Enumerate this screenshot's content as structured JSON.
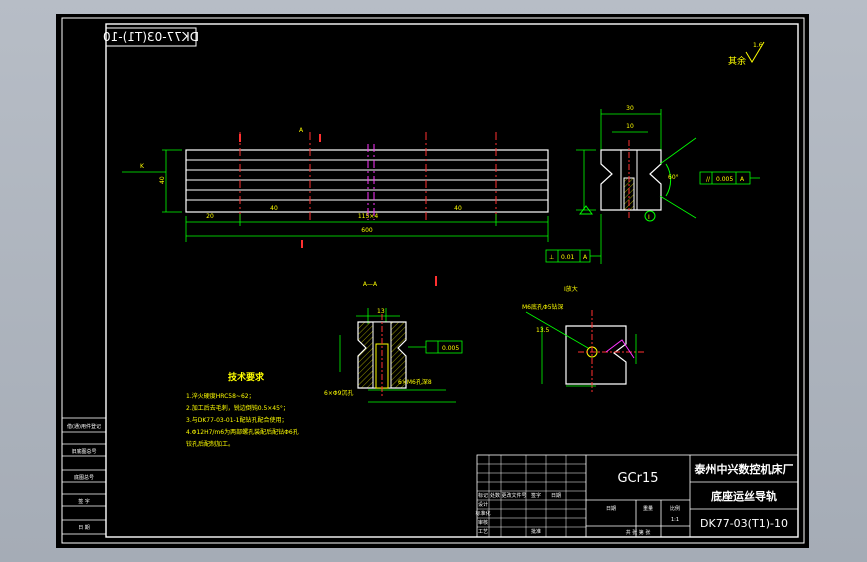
{
  "drawing": {
    "mirrored_code": "DK77-03(T1)-10",
    "roughness_note": "其余",
    "roughness_value": "1.6",
    "section_label": "A—A",
    "view_label": "I放大",
    "section_marker": "A",
    "dim_total": "600",
    "dim_spacing": "115×4",
    "dim_left_a": "40",
    "dim_left_b": "20",
    "dim_right_a": "40",
    "dim_height": "40",
    "dim_side_width": "30",
    "dim_side_inner": "10",
    "dim_angle": "60°",
    "flatness": "0.005",
    "parallel_a": "0.01",
    "parallel_ref": "A",
    "section_tol": "0.005",
    "section_dim_a": "13",
    "section_hole_a": "6×M6孔深8",
    "section_hole_b": "6×Φ9沉孔",
    "detail_note": "M6底孔Φ5钻深",
    "detail_dim": "13.5"
  },
  "tech_requirements": {
    "title": "技术要求",
    "items": [
      "1.淬火硬度HRC58~62；",
      "2.加工后去毛刺，锐边倒钝0.5×45°；",
      "3.与DK77-03-01-1配钻孔配合使用；",
      "4.Φ12H7/m6为两部螺孔装配后配钻Φ6孔",
      "  铰孔后配制加工。"
    ]
  },
  "left_strip": {
    "rows": [
      "借(通)用件登记",
      "",
      "旧底图总号",
      "",
      "底图总号",
      "",
      "签  字",
      "",
      "日  期"
    ]
  },
  "title_block": {
    "material": "GCr15",
    "company": "泰州中兴数控机床厂",
    "part_name": "底座运丝导轨",
    "drawing_number": "DK77-03(T1)-10",
    "scale": "1:1",
    "headers": [
      "标记",
      "处数",
      "更改文件号",
      "签字",
      "日期"
    ],
    "roles": [
      "设计",
      "标准化",
      "审核",
      "工艺",
      "批准"
    ],
    "sheet": "共  张  第  张",
    "date_label": "日期",
    "weight_label": "重量",
    "scale_label": "比例"
  }
}
